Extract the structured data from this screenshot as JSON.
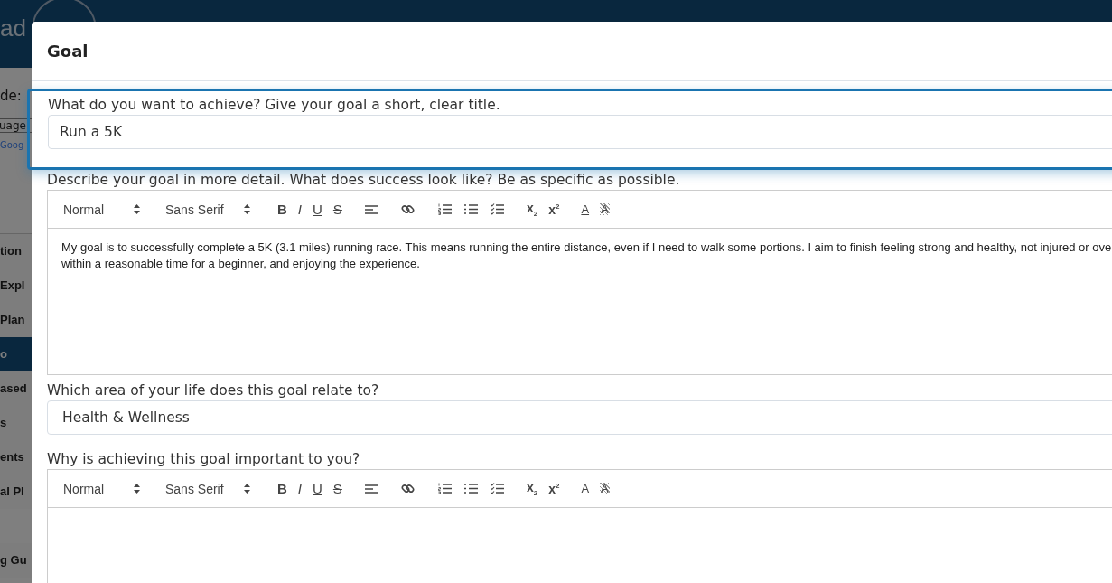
{
  "background": {
    "logo": "ad",
    "code_label": "de:",
    "language": "uage",
    "google": "Goog",
    "sidebar": [
      {
        "label": "tion",
        "selected": false
      },
      {
        "label": "Expl",
        "selected": false
      },
      {
        "label": "Plan",
        "selected": false
      },
      {
        "label": "o",
        "selected": true
      },
      {
        "label": "ased",
        "selected": false
      },
      {
        "label": "s",
        "selected": false
      },
      {
        "label": "ents",
        "selected": false
      },
      {
        "label": "al Pl",
        "selected": false
      },
      {
        "label": "g Gu",
        "selected": false
      }
    ]
  },
  "modal": {
    "title": "Goal",
    "fields": [
      {
        "kind": "input",
        "label": "What do you want to achieve? Give your goal a short, clear title.",
        "value": "Run a 5K",
        "focused": true
      },
      {
        "kind": "editor",
        "label": "Describe your goal in more detail. What does success look like? Be as specific as possible.",
        "header": "Normal",
        "font": "Sans Serif",
        "lines": [
          "My goal is to successfully complete a 5K (3.1 miles) running race. This means running the entire distance, even if I need to walk some portions. I aim to finish feeling strong and healthy, not injured or ove",
          "within a reasonable time for a beginner, and enjoying the experience."
        ],
        "toolbar": [
          {
            "kind": "bold",
            "label": "B"
          },
          {
            "kind": "italic",
            "label": "I"
          },
          {
            "kind": "underline",
            "label": "U"
          },
          {
            "kind": "strike",
            "label": "S"
          },
          {
            "kind": "gap"
          },
          {
            "kind": "align"
          },
          {
            "kind": "gap"
          },
          {
            "kind": "link"
          },
          {
            "kind": "gap"
          },
          {
            "kind": "ordered"
          },
          {
            "kind": "bullet"
          },
          {
            "kind": "check"
          },
          {
            "kind": "gap"
          },
          {
            "kind": "sub",
            "label": "x",
            "mark": "2"
          },
          {
            "kind": "super",
            "label": "x",
            "mark": "2"
          },
          {
            "kind": "gap"
          },
          {
            "kind": "color",
            "label": "A"
          },
          {
            "kind": "background",
            "label": "A"
          }
        ]
      },
      {
        "kind": "select",
        "label": "Which area of your life does this goal relate to?",
        "value": "Health & Wellness"
      },
      {
        "kind": "editor",
        "label": "Why is achieving this goal important to you?",
        "header": "Normal",
        "font": "Sans Serif",
        "toolbar": [
          {
            "kind": "bold",
            "label": "B"
          },
          {
            "kind": "italic",
            "label": "I"
          },
          {
            "kind": "underline",
            "label": "U"
          },
          {
            "kind": "strike",
            "label": "S"
          },
          {
            "kind": "gap"
          },
          {
            "kind": "align"
          },
          {
            "kind": "gap"
          },
          {
            "kind": "link"
          },
          {
            "kind": "gap"
          },
          {
            "kind": "ordered"
          },
          {
            "kind": "bullet"
          },
          {
            "kind": "check"
          },
          {
            "kind": "gap"
          },
          {
            "kind": "sub",
            "label": "x",
            "mark": "2"
          },
          {
            "kind": "super",
            "label": "x",
            "mark": "2"
          },
          {
            "kind": "gap"
          },
          {
            "kind": "color",
            "label": "A"
          },
          {
            "kind": "background",
            "label": "A"
          }
        ]
      }
    ]
  }
}
